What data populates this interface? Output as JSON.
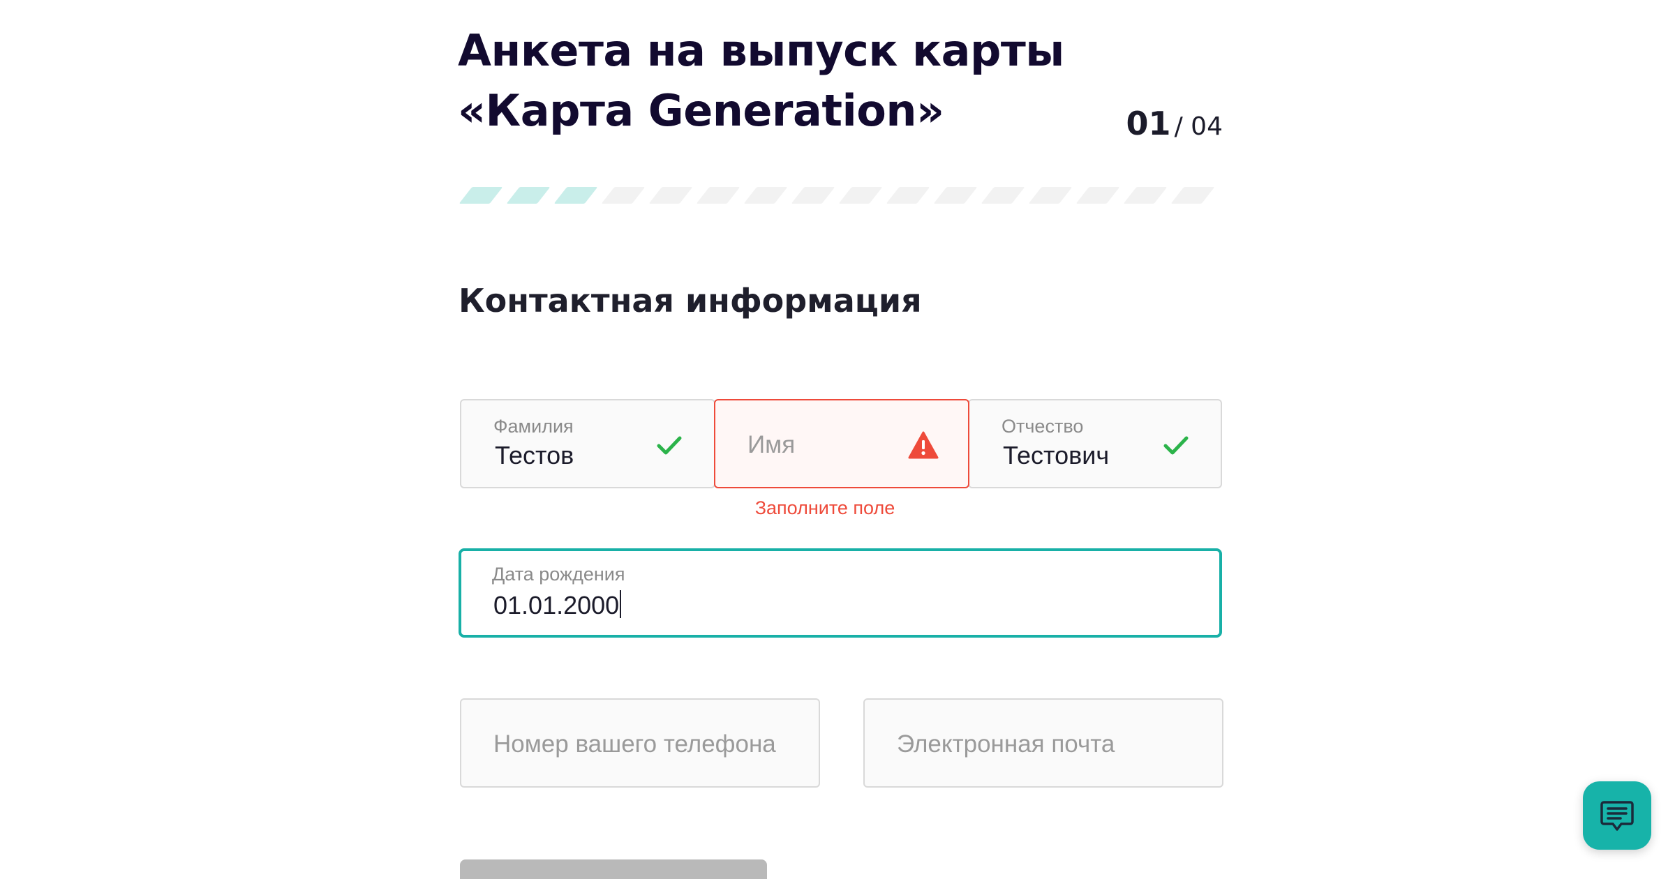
{
  "header": {
    "title": "Анкета на выпуск карты «Карта Generation»",
    "step_current": "01",
    "step_total": "/ 04"
  },
  "progress": {
    "steps_completed": 1,
    "steps_total": 4
  },
  "section": {
    "title": "Контактная информация"
  },
  "form": {
    "surname": {
      "label": "Фамилия",
      "value": "Тестов",
      "status": "valid"
    },
    "name": {
      "placeholder": "Имя",
      "status": "error",
      "error": "Заполните поле"
    },
    "patronymic": {
      "label": "Отчество",
      "value": "Тестович",
      "status": "valid"
    },
    "birthdate": {
      "label": "Дата рождения",
      "value": "01.01.2000",
      "status": "focused"
    },
    "phone": {
      "placeholder": "Номер вашего телефона"
    },
    "email": {
      "placeholder": "Электронная почта"
    }
  },
  "icons": {
    "valid": "checkmark-icon",
    "error": "warning-icon",
    "chat": "chat-icon"
  },
  "colors": {
    "accent": "#18b0a7",
    "error": "#ee4a3a",
    "valid": "#2bb34a",
    "title": "#120a2f"
  }
}
